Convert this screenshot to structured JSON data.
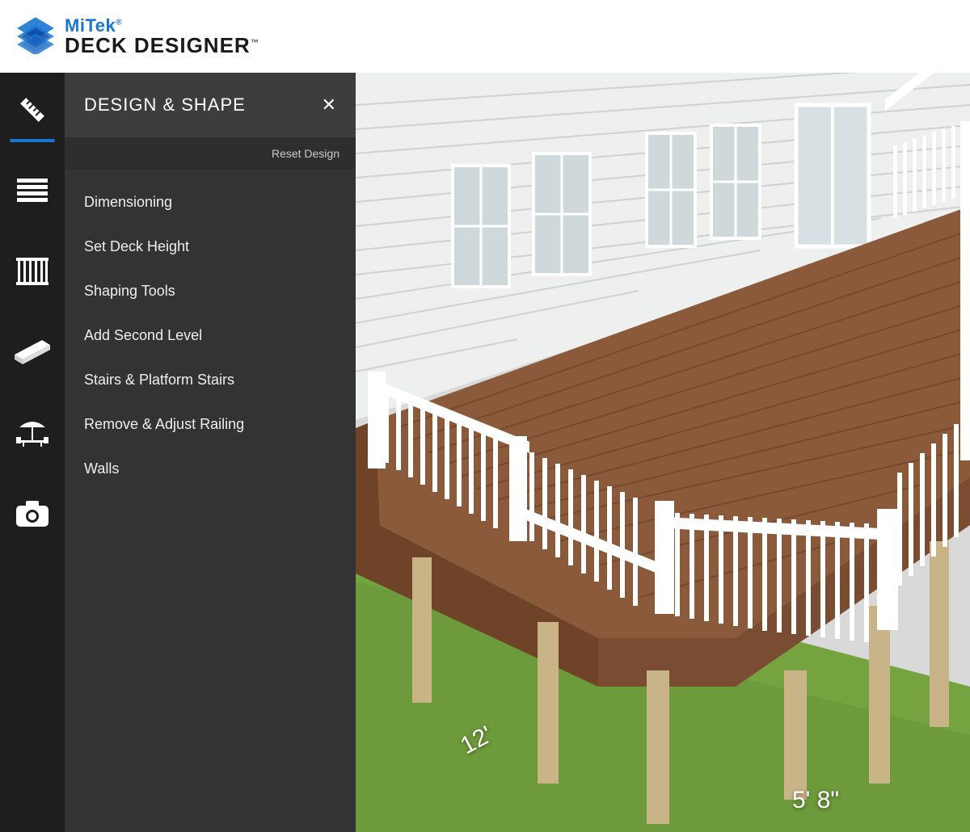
{
  "header": {
    "brand_top": "MiTek",
    "brand_bottom": "DECK DESIGNER"
  },
  "rail": {
    "items": [
      {
        "name": "design-shape",
        "icon": "ruler-icon",
        "active": true
      },
      {
        "name": "decking",
        "icon": "boards-icon",
        "active": false
      },
      {
        "name": "railing",
        "icon": "railing-icon",
        "active": false
      },
      {
        "name": "structure",
        "icon": "joist-icon",
        "active": false
      },
      {
        "name": "accessories",
        "icon": "umbrella-icon",
        "active": false
      },
      {
        "name": "snapshot",
        "icon": "camera-icon",
        "active": false
      }
    ]
  },
  "panel": {
    "title": "DESIGN & SHAPE",
    "reset_label": "Reset Design",
    "items": [
      "Dimensioning",
      "Set Deck Height",
      "Shaping Tools",
      "Add Second Level",
      "Stairs & Platform Stairs",
      "Remove & Adjust Railing",
      "Walls"
    ]
  },
  "viewport": {
    "dimensions": {
      "side": "12'",
      "front": "5' 8\""
    }
  },
  "colors": {
    "accent": "#1976d2",
    "rail_bg": "#1e1e1e",
    "panel_bg": "#333333",
    "deck": "#8a5a3b",
    "grass": "#6d9a3a",
    "house": "#eef0ef"
  }
}
